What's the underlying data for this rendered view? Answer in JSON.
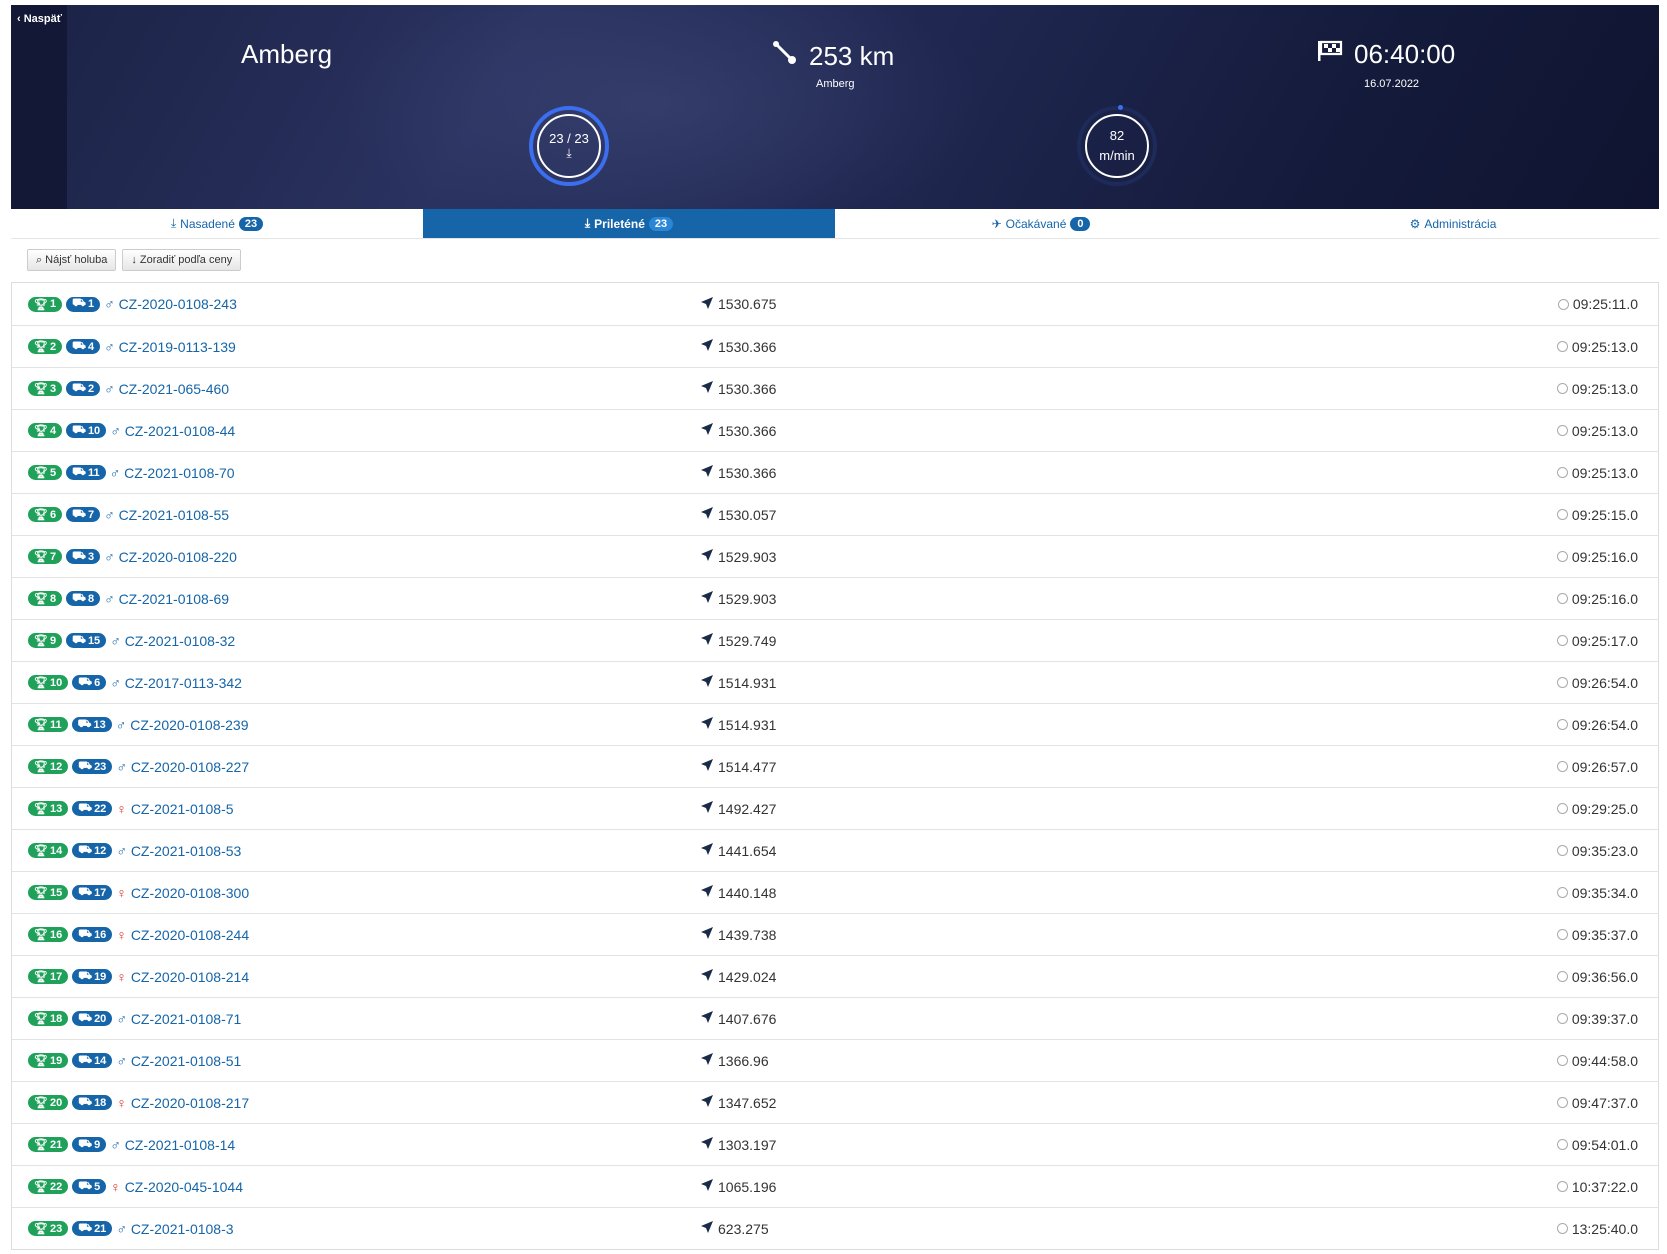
{
  "header": {
    "back_label": "Naspäť",
    "race_name": "Amberg",
    "distance": "253 km",
    "distance_sub": "Amberg",
    "release_time": "06:40:00",
    "release_date": "16.07.2022",
    "gauge_arrived": "23 / 23",
    "gauge_speed_value": "82",
    "gauge_speed_unit": "m/min"
  },
  "tabs": [
    {
      "label": "Nasadené",
      "count": "23"
    },
    {
      "label": "Prileténé",
      "count": "23"
    },
    {
      "label": "Očakávané",
      "count": "0"
    },
    {
      "label": "Administrácia"
    }
  ],
  "toolbar": {
    "find_label": "Nájsť holuba",
    "sort_label": "Zoradiť podľa ceny"
  },
  "colors": {
    "accent": "#1565a8",
    "green": "#1fa15a",
    "female": "#d9342b"
  },
  "rows": [
    {
      "rank": "1",
      "basket": "1",
      "sex": "♂",
      "ring": "CZ-2020-0108-243",
      "speed": "1530.675",
      "time": "09:25:11.0"
    },
    {
      "rank": "2",
      "basket": "4",
      "sex": "♂",
      "ring": "CZ-2019-0113-139",
      "speed": "1530.366",
      "time": "09:25:13.0"
    },
    {
      "rank": "3",
      "basket": "2",
      "sex": "♂",
      "ring": "CZ-2021-065-460",
      "speed": "1530.366",
      "time": "09:25:13.0"
    },
    {
      "rank": "4",
      "basket": "10",
      "sex": "♂",
      "ring": "CZ-2021-0108-44",
      "speed": "1530.366",
      "time": "09:25:13.0"
    },
    {
      "rank": "5",
      "basket": "11",
      "sex": "♂",
      "ring": "CZ-2021-0108-70",
      "speed": "1530.366",
      "time": "09:25:13.0"
    },
    {
      "rank": "6",
      "basket": "7",
      "sex": "♂",
      "ring": "CZ-2021-0108-55",
      "speed": "1530.057",
      "time": "09:25:15.0"
    },
    {
      "rank": "7",
      "basket": "3",
      "sex": "♂",
      "ring": "CZ-2020-0108-220",
      "speed": "1529.903",
      "time": "09:25:16.0"
    },
    {
      "rank": "8",
      "basket": "8",
      "sex": "♂",
      "ring": "CZ-2021-0108-69",
      "speed": "1529.903",
      "time": "09:25:16.0"
    },
    {
      "rank": "9",
      "basket": "15",
      "sex": "♂",
      "ring": "CZ-2021-0108-32",
      "speed": "1529.749",
      "time": "09:25:17.0"
    },
    {
      "rank": "10",
      "basket": "6",
      "sex": "♂",
      "ring": "CZ-2017-0113-342",
      "speed": "1514.931",
      "time": "09:26:54.0"
    },
    {
      "rank": "11",
      "basket": "13",
      "sex": "♂",
      "ring": "CZ-2020-0108-239",
      "speed": "1514.931",
      "time": "09:26:54.0"
    },
    {
      "rank": "12",
      "basket": "23",
      "sex": "♂",
      "ring": "CZ-2020-0108-227",
      "speed": "1514.477",
      "time": "09:26:57.0"
    },
    {
      "rank": "13",
      "basket": "22",
      "sex": "♀",
      "ring": "CZ-2021-0108-5",
      "speed": "1492.427",
      "time": "09:29:25.0"
    },
    {
      "rank": "14",
      "basket": "12",
      "sex": "♂",
      "ring": "CZ-2021-0108-53",
      "speed": "1441.654",
      "time": "09:35:23.0"
    },
    {
      "rank": "15",
      "basket": "17",
      "sex": "♀",
      "ring": "CZ-2020-0108-300",
      "speed": "1440.148",
      "time": "09:35:34.0"
    },
    {
      "rank": "16",
      "basket": "16",
      "sex": "♀",
      "ring": "CZ-2020-0108-244",
      "speed": "1439.738",
      "time": "09:35:37.0"
    },
    {
      "rank": "17",
      "basket": "19",
      "sex": "♀",
      "ring": "CZ-2020-0108-214",
      "speed": "1429.024",
      "time": "09:36:56.0"
    },
    {
      "rank": "18",
      "basket": "20",
      "sex": "♂",
      "ring": "CZ-2021-0108-71",
      "speed": "1407.676",
      "time": "09:39:37.0"
    },
    {
      "rank": "19",
      "basket": "14",
      "sex": "♂",
      "ring": "CZ-2021-0108-51",
      "speed": "1366.96",
      "time": "09:44:58.0"
    },
    {
      "rank": "20",
      "basket": "18",
      "sex": "♀",
      "ring": "CZ-2020-0108-217",
      "speed": "1347.652",
      "time": "09:47:37.0"
    },
    {
      "rank": "21",
      "basket": "9",
      "sex": "♂",
      "ring": "CZ-2021-0108-14",
      "speed": "1303.197",
      "time": "09:54:01.0"
    },
    {
      "rank": "22",
      "basket": "5",
      "sex": "♀",
      "ring": "CZ-2020-045-1044",
      "speed": "1065.196",
      "time": "10:37:22.0"
    },
    {
      "rank": "23",
      "basket": "21",
      "sex": "♂",
      "ring": "CZ-2021-0108-3",
      "speed": "623.275",
      "time": "13:25:40.0"
    }
  ]
}
